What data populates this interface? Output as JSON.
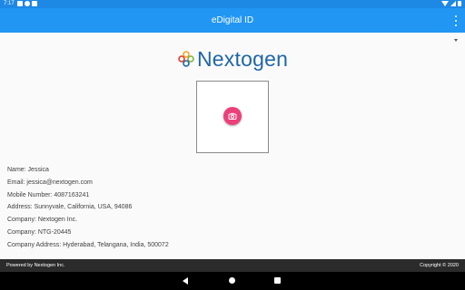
{
  "status_bar": {
    "time": "7:17"
  },
  "app_bar": {
    "title": "eDigital ID"
  },
  "logo": {
    "text": "Nextogen"
  },
  "profile": {
    "lines": [
      "Name: Jessica",
      "Email: jessica@nextogen.com",
      "Mobile Number: 4087163241",
      "Address: Sunnyvale, California, USA, 94086",
      "Company: Nextogen Inc.",
      "Company: NTG-20445",
      "Company Address: Hyderabad, Telangana, India, 500072"
    ]
  },
  "footer": {
    "left": "Powered by Nextogen Inc.",
    "right": "Copyright © 2020"
  },
  "colors": {
    "status_bar": "#1e88e5",
    "app_bar": "#2196f3",
    "fab": "#ec407a",
    "brand": "#1f66a8",
    "footer": "#2b2b2b"
  },
  "icons": {
    "overflow": "more-vert-icon",
    "photo": "camera-icon",
    "back": "back-icon",
    "home": "home-icon",
    "recents": "recents-icon"
  }
}
